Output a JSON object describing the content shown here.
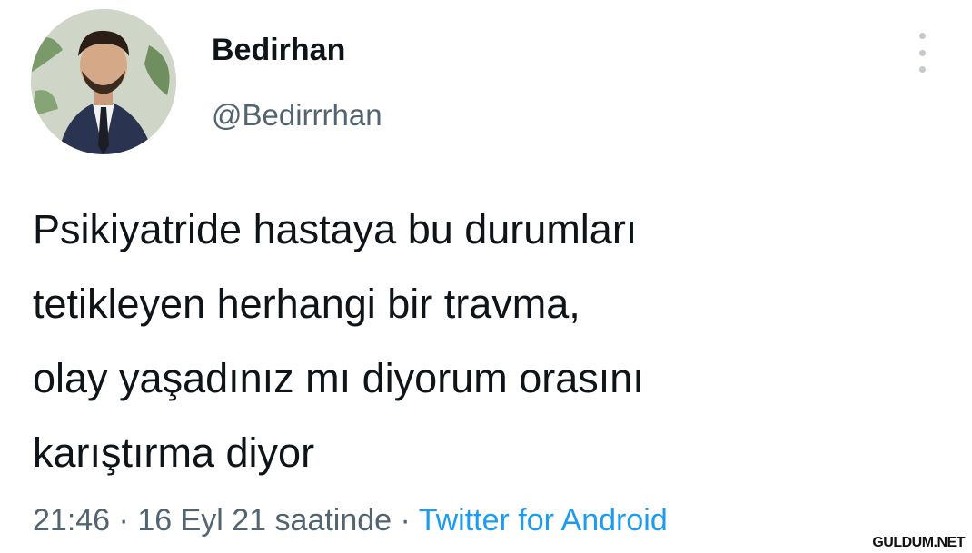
{
  "tweet": {
    "author": {
      "display_name": "Bedirhan",
      "handle": "@Bedirrrhan",
      "avatar": "profile-photo"
    },
    "more_icon": "more-vertical-icon",
    "text_lines": [
      "Psikiyatride hastaya bu durumları",
      "tetikleyen herhangi bir travma,",
      "olay yaşadınız mı diyorum orasını",
      "karıştırma diyor"
    ],
    "time": "21:46",
    "date": "16 Eyl 21 saatinde",
    "separator": "·",
    "source": "Twitter for Android"
  },
  "watermark": "GULDUM.NET",
  "colors": {
    "text": "#0f1419",
    "secondary": "#536471",
    "link": "#1d9bf0"
  }
}
